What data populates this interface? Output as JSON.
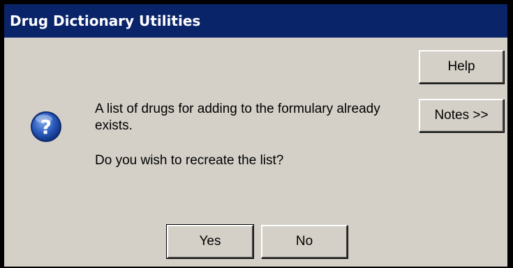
{
  "window": {
    "title": "Drug Dictionary Utilities"
  },
  "buttons": {
    "help": "Help",
    "notes": "Notes >>",
    "yes": "Yes",
    "no": "No"
  },
  "message": {
    "line1": "A list of drugs for adding to the formulary already exists.",
    "line2": "Do you wish to recreate the list?"
  },
  "icon": {
    "name": "question-icon",
    "color": "#1c4fa8"
  },
  "colors": {
    "titlebar": "#0a246a",
    "dialog_bg": "#d4d0c8"
  }
}
